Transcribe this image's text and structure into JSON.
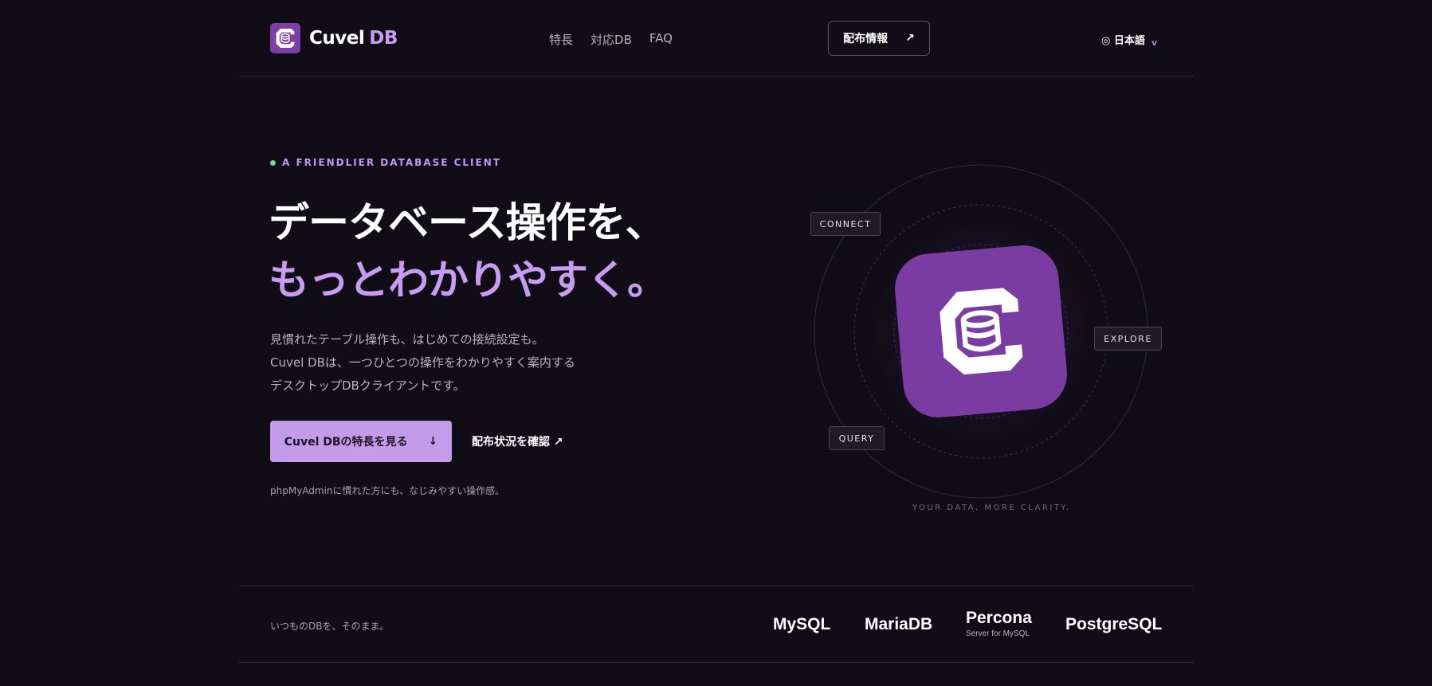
{
  "brand": {
    "name_part1": "Cuvel",
    "name_part2": "DB"
  },
  "nav": {
    "items": [
      "特長",
      "対応DB",
      "FAQ"
    ]
  },
  "header": {
    "cta_label": "配布情報",
    "cta_arrow": "↗",
    "language": "◎ 日本語",
    "language_chevron": "v"
  },
  "hero": {
    "eyebrow": "A FRIENDLIER DATABASE CLIENT",
    "headline_line1": "データベース操作を、",
    "headline_line2": "もっとわかりやすく。",
    "lead": [
      "見慣れたテーブル操作も、はじめての接続設定も。",
      "Cuvel DBは、一つひとつの操作をわかりやすく案内する",
      "デスクトップDBクライアントです。"
    ],
    "primary_label": "Cuvel DBの特長を見る",
    "primary_arrow": "↓",
    "secondary_label": "配布状況を確認 ↗",
    "note": "phpMyAdminに慣れた方にも、なじみやすい操作感。"
  },
  "illustration": {
    "tags": {
      "connect": "CONNECT",
      "explore": "EXPLORE",
      "query": "QUERY"
    },
    "tagline": "YOUR DATA. MORE CLARITY."
  },
  "databases": {
    "label": "いつものDBを、そのまま。",
    "items": [
      {
        "name": "MySQL"
      },
      {
        "name": "MariaDB"
      },
      {
        "name": "Percona",
        "sub": "Server for MySQL"
      },
      {
        "name": "PostgreSQL"
      }
    ]
  },
  "colors": {
    "background": "#100d17",
    "accent": "#c39be8",
    "brand_purple": "#7b3fa6",
    "status_dot": "#7fd1a5"
  }
}
